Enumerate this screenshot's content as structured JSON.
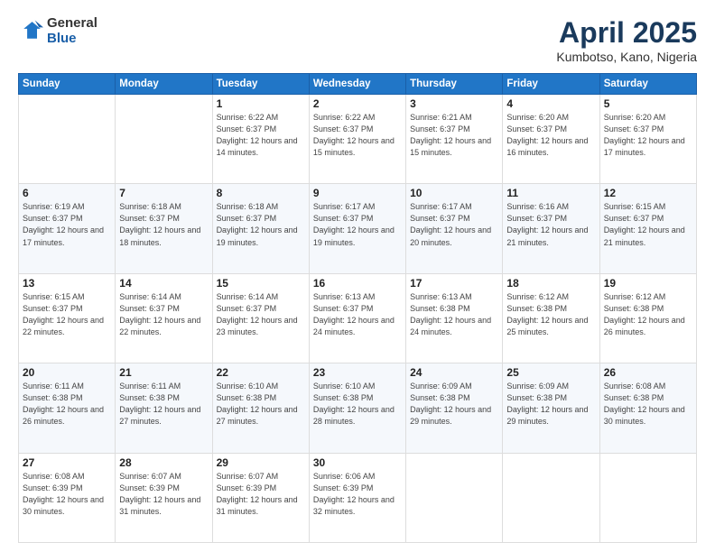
{
  "logo": {
    "general": "General",
    "blue": "Blue"
  },
  "title": {
    "month": "April 2025",
    "location": "Kumbotso, Kano, Nigeria"
  },
  "days_header": [
    "Sunday",
    "Monday",
    "Tuesday",
    "Wednesday",
    "Thursday",
    "Friday",
    "Saturday"
  ],
  "weeks": [
    [
      {
        "day": "",
        "info": ""
      },
      {
        "day": "",
        "info": ""
      },
      {
        "day": "1",
        "info": "Sunrise: 6:22 AM\nSunset: 6:37 PM\nDaylight: 12 hours and 14 minutes."
      },
      {
        "day": "2",
        "info": "Sunrise: 6:22 AM\nSunset: 6:37 PM\nDaylight: 12 hours and 15 minutes."
      },
      {
        "day": "3",
        "info": "Sunrise: 6:21 AM\nSunset: 6:37 PM\nDaylight: 12 hours and 15 minutes."
      },
      {
        "day": "4",
        "info": "Sunrise: 6:20 AM\nSunset: 6:37 PM\nDaylight: 12 hours and 16 minutes."
      },
      {
        "day": "5",
        "info": "Sunrise: 6:20 AM\nSunset: 6:37 PM\nDaylight: 12 hours and 17 minutes."
      }
    ],
    [
      {
        "day": "6",
        "info": "Sunrise: 6:19 AM\nSunset: 6:37 PM\nDaylight: 12 hours and 17 minutes."
      },
      {
        "day": "7",
        "info": "Sunrise: 6:18 AM\nSunset: 6:37 PM\nDaylight: 12 hours and 18 minutes."
      },
      {
        "day": "8",
        "info": "Sunrise: 6:18 AM\nSunset: 6:37 PM\nDaylight: 12 hours and 19 minutes."
      },
      {
        "day": "9",
        "info": "Sunrise: 6:17 AM\nSunset: 6:37 PM\nDaylight: 12 hours and 19 minutes."
      },
      {
        "day": "10",
        "info": "Sunrise: 6:17 AM\nSunset: 6:37 PM\nDaylight: 12 hours and 20 minutes."
      },
      {
        "day": "11",
        "info": "Sunrise: 6:16 AM\nSunset: 6:37 PM\nDaylight: 12 hours and 21 minutes."
      },
      {
        "day": "12",
        "info": "Sunrise: 6:15 AM\nSunset: 6:37 PM\nDaylight: 12 hours and 21 minutes."
      }
    ],
    [
      {
        "day": "13",
        "info": "Sunrise: 6:15 AM\nSunset: 6:37 PM\nDaylight: 12 hours and 22 minutes."
      },
      {
        "day": "14",
        "info": "Sunrise: 6:14 AM\nSunset: 6:37 PM\nDaylight: 12 hours and 22 minutes."
      },
      {
        "day": "15",
        "info": "Sunrise: 6:14 AM\nSunset: 6:37 PM\nDaylight: 12 hours and 23 minutes."
      },
      {
        "day": "16",
        "info": "Sunrise: 6:13 AM\nSunset: 6:37 PM\nDaylight: 12 hours and 24 minutes."
      },
      {
        "day": "17",
        "info": "Sunrise: 6:13 AM\nSunset: 6:38 PM\nDaylight: 12 hours and 24 minutes."
      },
      {
        "day": "18",
        "info": "Sunrise: 6:12 AM\nSunset: 6:38 PM\nDaylight: 12 hours and 25 minutes."
      },
      {
        "day": "19",
        "info": "Sunrise: 6:12 AM\nSunset: 6:38 PM\nDaylight: 12 hours and 26 minutes."
      }
    ],
    [
      {
        "day": "20",
        "info": "Sunrise: 6:11 AM\nSunset: 6:38 PM\nDaylight: 12 hours and 26 minutes."
      },
      {
        "day": "21",
        "info": "Sunrise: 6:11 AM\nSunset: 6:38 PM\nDaylight: 12 hours and 27 minutes."
      },
      {
        "day": "22",
        "info": "Sunrise: 6:10 AM\nSunset: 6:38 PM\nDaylight: 12 hours and 27 minutes."
      },
      {
        "day": "23",
        "info": "Sunrise: 6:10 AM\nSunset: 6:38 PM\nDaylight: 12 hours and 28 minutes."
      },
      {
        "day": "24",
        "info": "Sunrise: 6:09 AM\nSunset: 6:38 PM\nDaylight: 12 hours and 29 minutes."
      },
      {
        "day": "25",
        "info": "Sunrise: 6:09 AM\nSunset: 6:38 PM\nDaylight: 12 hours and 29 minutes."
      },
      {
        "day": "26",
        "info": "Sunrise: 6:08 AM\nSunset: 6:38 PM\nDaylight: 12 hours and 30 minutes."
      }
    ],
    [
      {
        "day": "27",
        "info": "Sunrise: 6:08 AM\nSunset: 6:39 PM\nDaylight: 12 hours and 30 minutes."
      },
      {
        "day": "28",
        "info": "Sunrise: 6:07 AM\nSunset: 6:39 PM\nDaylight: 12 hours and 31 minutes."
      },
      {
        "day": "29",
        "info": "Sunrise: 6:07 AM\nSunset: 6:39 PM\nDaylight: 12 hours and 31 minutes."
      },
      {
        "day": "30",
        "info": "Sunrise: 6:06 AM\nSunset: 6:39 PM\nDaylight: 12 hours and 32 minutes."
      },
      {
        "day": "",
        "info": ""
      },
      {
        "day": "",
        "info": ""
      },
      {
        "day": "",
        "info": ""
      }
    ]
  ]
}
